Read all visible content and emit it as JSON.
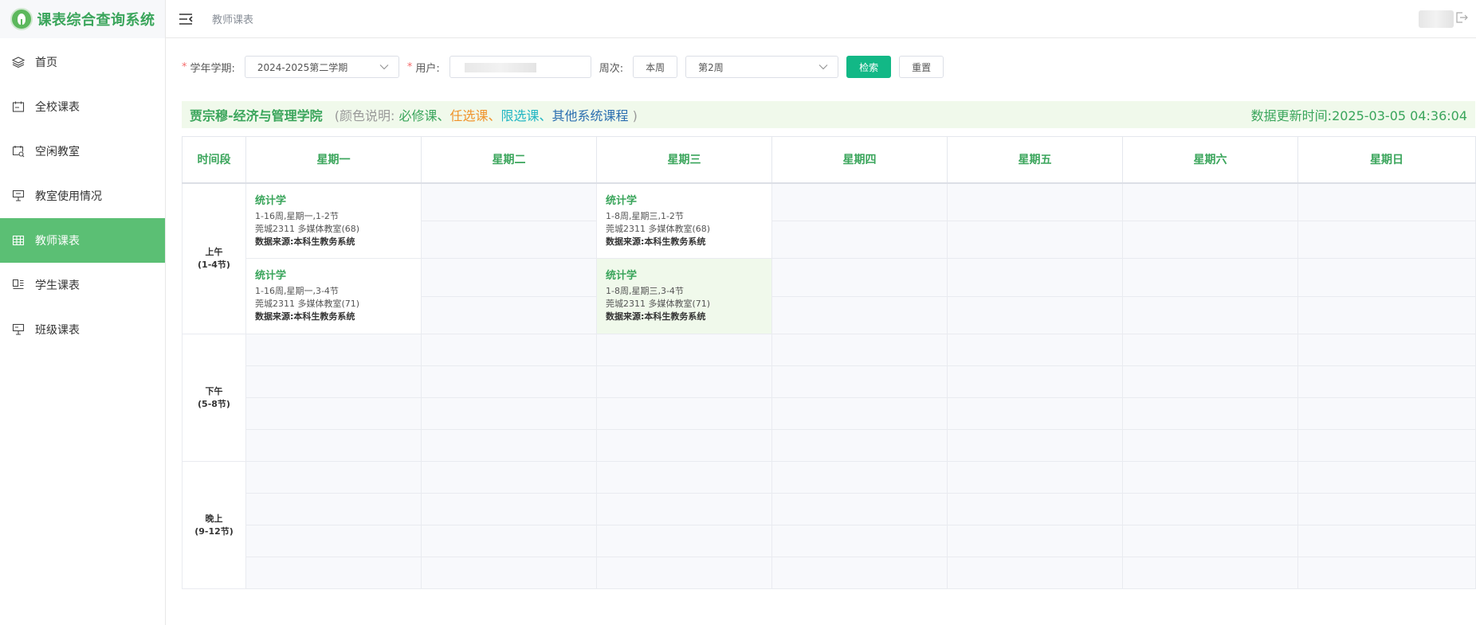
{
  "app": {
    "title": "课表综合查询系统"
  },
  "sidebar": {
    "items": [
      {
        "label": "首页",
        "icon": "layers-icon",
        "name": "home"
      },
      {
        "label": "全校课表",
        "icon": "calendar-icon",
        "name": "school-schedule"
      },
      {
        "label": "空闲教室",
        "icon": "room-search-icon",
        "name": "free-classroom"
      },
      {
        "label": "教室使用情况",
        "icon": "podium-icon",
        "name": "classroom-usage"
      },
      {
        "label": "教师课表",
        "icon": "table-icon",
        "name": "teacher-schedule",
        "active": true
      },
      {
        "label": "学生课表",
        "icon": "student-icon",
        "name": "student-schedule"
      },
      {
        "label": "班级课表",
        "icon": "class-icon",
        "name": "class-schedule"
      }
    ]
  },
  "header": {
    "breadcrumb": "教师课表"
  },
  "filters": {
    "term_label": "学年学期:",
    "term_value": "2024-2025第二学期",
    "user_label": "用户:",
    "week_label": "周次:",
    "this_week_button": "本周",
    "week_value": "第2周",
    "search_button": "检索",
    "reset_button": "重置"
  },
  "info": {
    "teacher": "贾宗穆-经济与管理学院",
    "legend_prefix": "(颜色说明:",
    "legend_required": "必修课、",
    "legend_elective": "任选课、",
    "legend_limited": "限选课、",
    "legend_other": "其他系统课程",
    "legend_suffix": ")",
    "update_time": "数据更新时间:2025-03-05 04:36:04"
  },
  "timetable": {
    "headers": [
      "时间段",
      "星期一",
      "星期二",
      "星期三",
      "星期四",
      "星期五",
      "星期六",
      "星期日"
    ],
    "periods": [
      {
        "label": "上午",
        "range": "(1-4节)"
      },
      {
        "label": "下午",
        "range": "(5-8节)"
      },
      {
        "label": "晚上",
        "range": "(9-12节)"
      }
    ],
    "courses": {
      "mon_12": {
        "name": "统计学",
        "weeks": "1-16周,星期一,1-2节",
        "room": "莞城2311 多媒体教室(68)",
        "source": "数据来源:本科生教务系统"
      },
      "wed_12": {
        "name": "统计学",
        "weeks": "1-8周,星期三,1-2节",
        "room": "莞城2311 多媒体教室(68)",
        "source": "数据来源:本科生教务系统"
      },
      "mon_34": {
        "name": "统计学",
        "weeks": "1-16周,星期一,3-4节",
        "room": "莞城2311 多媒体教室(71)",
        "source": "数据来源:本科生教务系统"
      },
      "wed_34": {
        "name": "统计学",
        "weeks": "1-8周,星期三,3-4节",
        "room": "莞城2311 多媒体教室(71)",
        "source": "数据来源:本科生教务系统"
      }
    }
  },
  "colors": {
    "brand": "#3aa55b",
    "active_nav": "#5bbf74",
    "primary_button": "#12b886",
    "elective": "#f0932b",
    "limited": "#1fb5c3",
    "other": "#2c6fb0"
  }
}
